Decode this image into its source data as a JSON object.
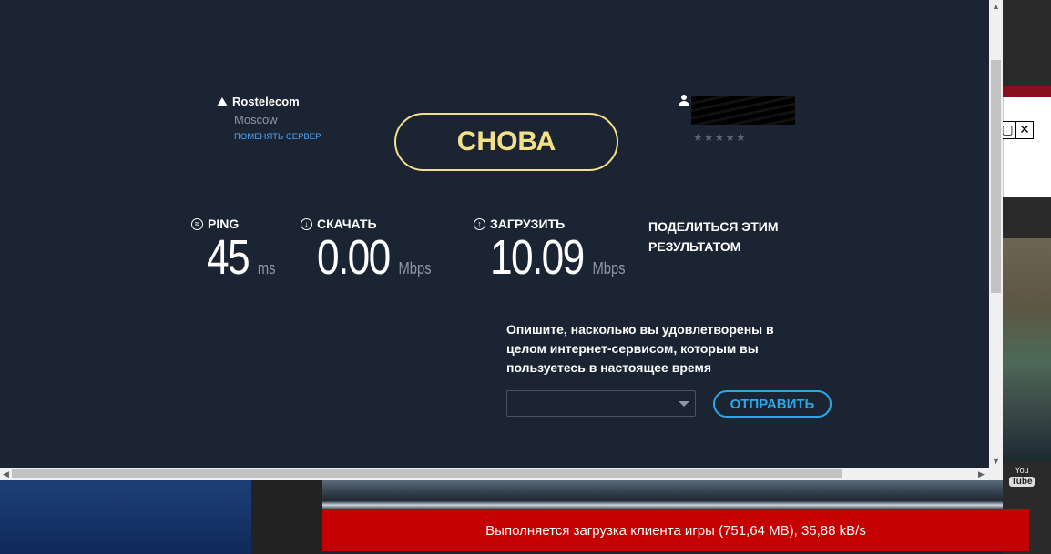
{
  "isp": {
    "name": "Rostelecom",
    "city": "Moscow",
    "change_server": "ПОМЕНЯТЬ СЕРВЕР"
  },
  "again_button": "СНОВА",
  "user": {
    "rating": "★★★★★"
  },
  "metrics": {
    "ping": {
      "label": "PING",
      "value": "45",
      "unit": "ms"
    },
    "download": {
      "label": "СКАЧАТЬ",
      "value": "0.00",
      "unit": "Mbps"
    },
    "upload": {
      "label": "ЗАГРУЗИТЬ",
      "value": "10.09",
      "unit": "Mbps"
    }
  },
  "share": {
    "line1": "ПОДЕЛИТЬСЯ ЭТИМ",
    "line2": "РЕЗУЛЬТАТОМ"
  },
  "survey": {
    "question": "Опишите, насколько вы удовлетворены в целом интернет-сервисом, которым вы пользуетесь в настоящее время",
    "select_value": "",
    "send_button": "ОТПРАВИТЬ"
  },
  "download_bar": "Выполняется загрузка клиента игры (751,64 MB), 35,88 kB/s",
  "youtube": {
    "line1": "You",
    "line2": "Tube"
  },
  "colors": {
    "background": "#1b2432",
    "again": "#f5e08a",
    "send": "#2ea7e8",
    "link": "#4aa8ff",
    "download_bar": "#c50000"
  }
}
